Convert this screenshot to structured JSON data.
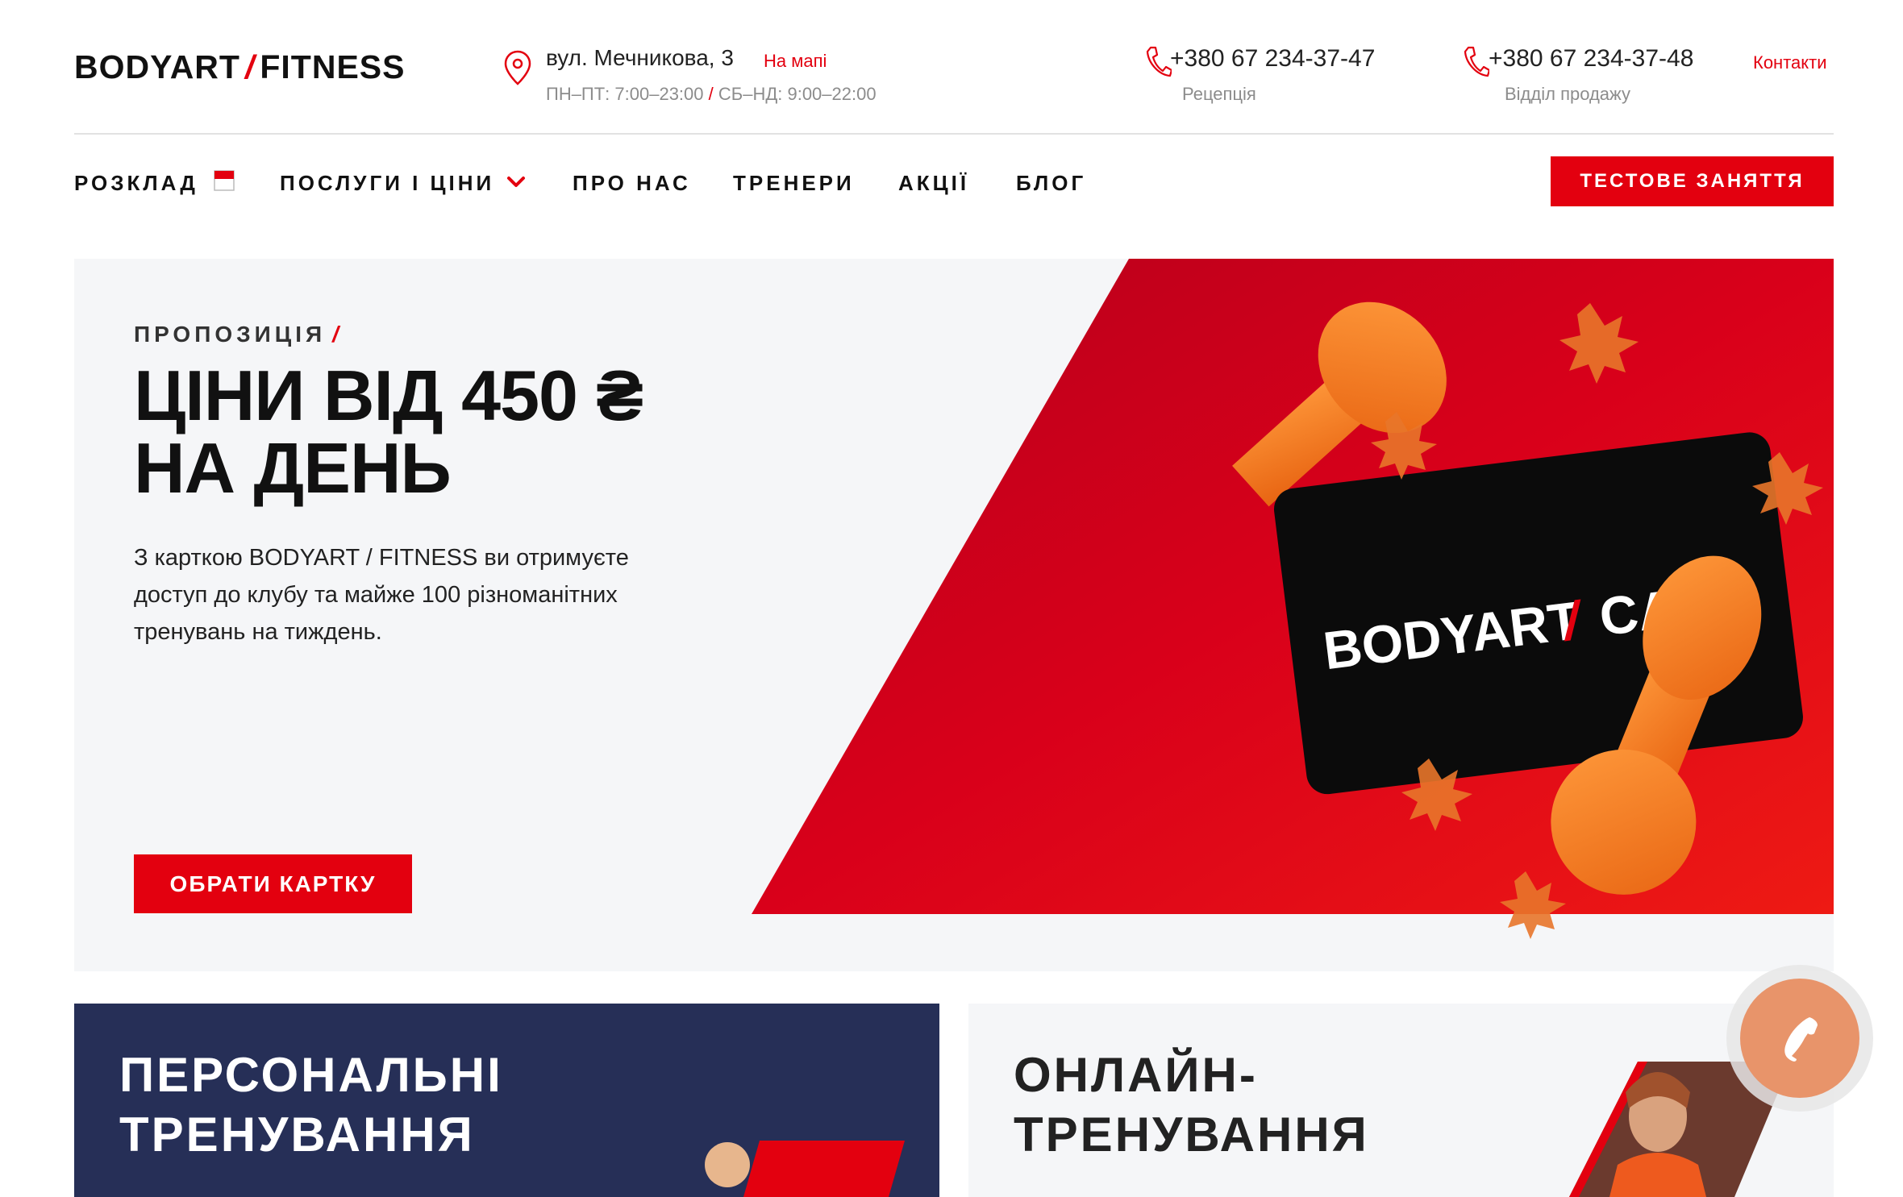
{
  "header": {
    "logo": {
      "left": "BODYART",
      "slash": "/",
      "right": "FITNESS"
    },
    "address": "вул. Мечникова, 3",
    "map_link": "На мапі",
    "hours": {
      "weekdays": "ПН–ПТ: 7:00–23:00",
      "separator": "/",
      "weekend": "СБ–НД: 9:00–22:00"
    },
    "phones": [
      {
        "number": "+380 67 234-37-47",
        "label": "Рецепція"
      },
      {
        "number": "+380 67 234-37-48",
        "label": "Відділ продажу"
      }
    ],
    "contacts_link": "Контакти"
  },
  "nav": {
    "items": [
      {
        "label": "РОЗКЛАД",
        "icon": "calendar-icon"
      },
      {
        "label": "ПОСЛУГИ І ЦІНИ",
        "icon": "chevron-down-icon"
      },
      {
        "label": "ПРО НАС"
      },
      {
        "label": "ТРЕНЕРИ"
      },
      {
        "label": "АКЦІЇ"
      },
      {
        "label": "БЛОГ"
      }
    ],
    "cta": "ТЕСТОВЕ ЗАНЯТТЯ"
  },
  "hero": {
    "eyebrow": "ПРОПОЗИЦІЯ",
    "eyebrow_slash": "/",
    "title_line1": "ЦІНИ ВІД 450 ₴",
    "title_line2": "НА ДЕНЬ",
    "text": "З карткою BODYART / FITNESS ви отримуєте доступ до клубу та майже 100 різноманітних тренувань на тиждень.",
    "button": "ОБРАТИ КАРТКУ",
    "card_brand_left": "BODYART",
    "card_brand_slash": "/",
    "card_brand_right": "CARD"
  },
  "cards": [
    {
      "title_line1": "ПЕРСОНАЛЬНІ",
      "title_line2": "ТРЕНУВАННЯ"
    },
    {
      "title_line1": "ОНЛАЙН-",
      "title_line2": "ТРЕНУВАННЯ"
    }
  ],
  "colors": {
    "accent": "#e3000f",
    "navy": "#262f57",
    "hero_bg": "#f5f6f8",
    "call_button": "#e8946a",
    "dumbbell": "#f07a1e",
    "card_black": "#0b0b0b"
  },
  "floating": {
    "icon": "phone-icon"
  }
}
